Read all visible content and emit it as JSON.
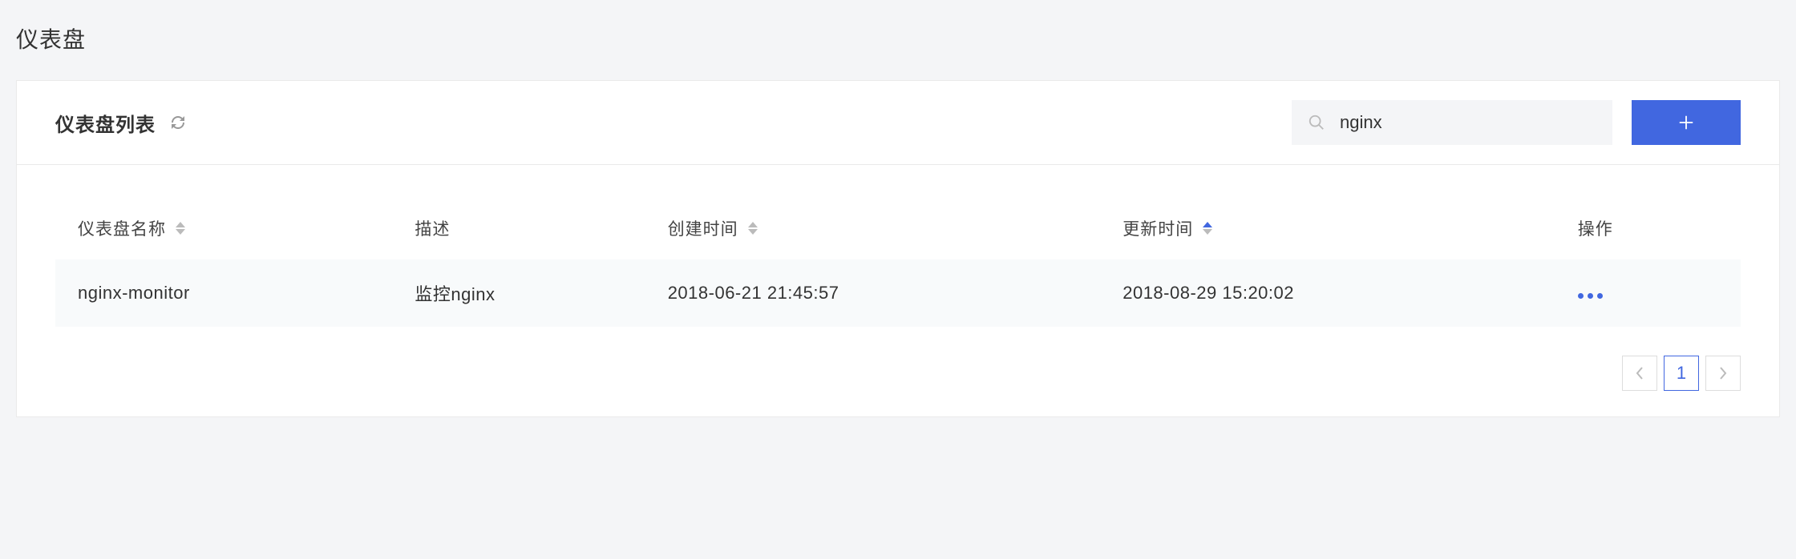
{
  "page": {
    "title": "仪表盘"
  },
  "panel": {
    "title": "仪表盘列表",
    "search": {
      "value": "nginx",
      "placeholder": ""
    }
  },
  "table": {
    "headers": {
      "name": "仪表盘名称",
      "description": "描述",
      "created": "创建时间",
      "updated": "更新时间",
      "actions": "操作"
    },
    "rows": [
      {
        "name": "nginx-monitor",
        "description": "监控nginx",
        "created": "2018-06-21 21:45:57",
        "updated": "2018-08-29 15:20:02"
      }
    ]
  },
  "pagination": {
    "current": "1"
  }
}
